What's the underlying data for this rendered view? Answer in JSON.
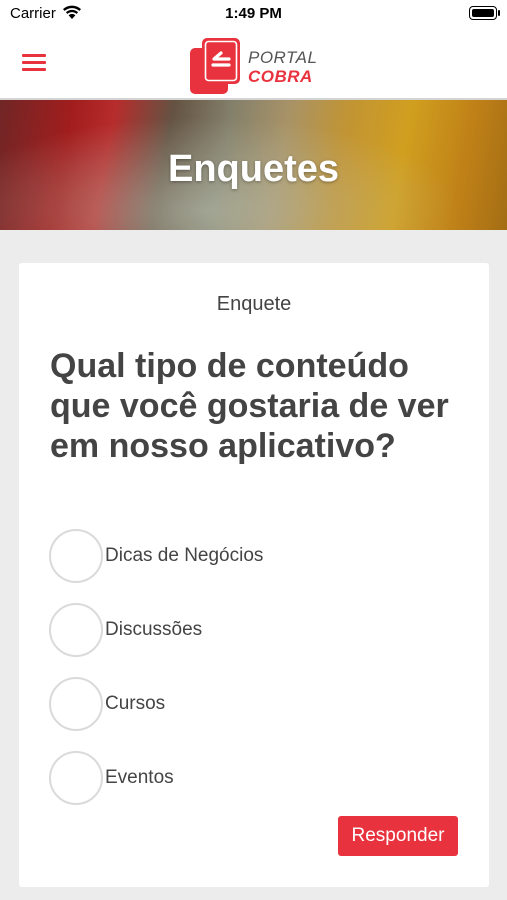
{
  "status_bar": {
    "carrier": "Carrier",
    "time": "1:49 PM"
  },
  "header": {
    "logo_top": "PORTAL",
    "logo_bottom": "COBRA",
    "brand_color": "#e8333e"
  },
  "banner": {
    "title": "Enquetes"
  },
  "poll": {
    "label": "Enquete",
    "question": "Qual tipo de conteúdo que você gostaria de ver em nosso aplicativo?",
    "options": [
      {
        "label": "Dicas de Negócios",
        "selected": false
      },
      {
        "label": "Discussões",
        "selected": false
      },
      {
        "label": "Cursos",
        "selected": false
      },
      {
        "label": "Eventos",
        "selected": false
      }
    ],
    "submit_label": "Responder"
  }
}
